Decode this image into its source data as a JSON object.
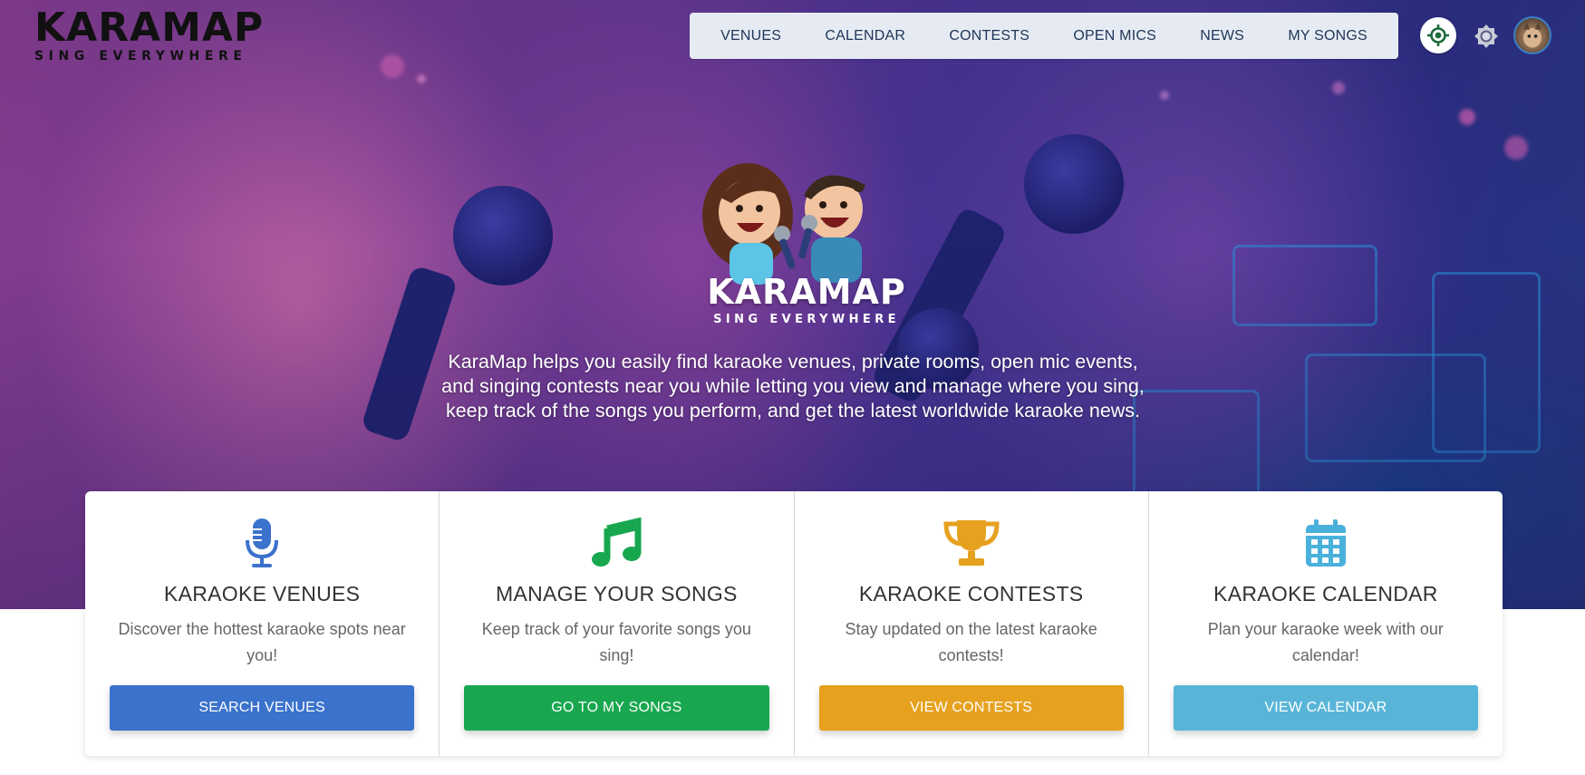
{
  "brand": {
    "name": "KARAMAP",
    "tagline": "SING EVERYWHERE"
  },
  "nav": {
    "items": [
      "VENUES",
      "CALENDAR",
      "CONTESTS",
      "OPEN MICS",
      "NEWS",
      "MY SONGS"
    ]
  },
  "header_icons": {
    "location": "location-crosshair-icon",
    "theme": "sun-brightness-icon",
    "avatar": "user-avatar"
  },
  "hero": {
    "logo_title": "KARAMAP",
    "logo_tagline": "SING EVERYWHERE",
    "intro_lines": [
      "KaraMap helps you easily find karaoke venues, private rooms, open mic events,",
      "and singing contests near you while letting you view and manage where you sing,",
      "keep track of the songs you perform, and get the latest worldwide karaoke news."
    ]
  },
  "cards": [
    {
      "icon": "microphone-icon",
      "title": "KARAOKE VENUES",
      "text": "Discover the hottest karaoke spots near you!",
      "button": "SEARCH VENUES",
      "color": "#3a72cc",
      "icon_color": "#3a72cc"
    },
    {
      "icon": "music-note-icon",
      "title": "MANAGE YOUR SONGS",
      "text": "Keep track of your favorite songs you sing!",
      "button": "GO TO MY SONGS",
      "color": "#18a74f",
      "icon_color": "#18a74f"
    },
    {
      "icon": "trophy-icon",
      "title": "KARAOKE CONTESTS",
      "text": "Stay updated on the latest karaoke contests!",
      "button": "VIEW CONTESTS",
      "color": "#e6a11e",
      "icon_color": "#e6a11e"
    },
    {
      "icon": "calendar-icon",
      "title": "KARAOKE CALENDAR",
      "text": "Plan your karaoke week with our calendar!",
      "button": "VIEW CALENDAR",
      "color": "#58b5d8",
      "icon_color": "#4ab0dc"
    }
  ],
  "colors": {
    "nav_bg": "#e6ebf3",
    "nav_text": "#1d3558",
    "location_green": "#1b6b3a"
  }
}
